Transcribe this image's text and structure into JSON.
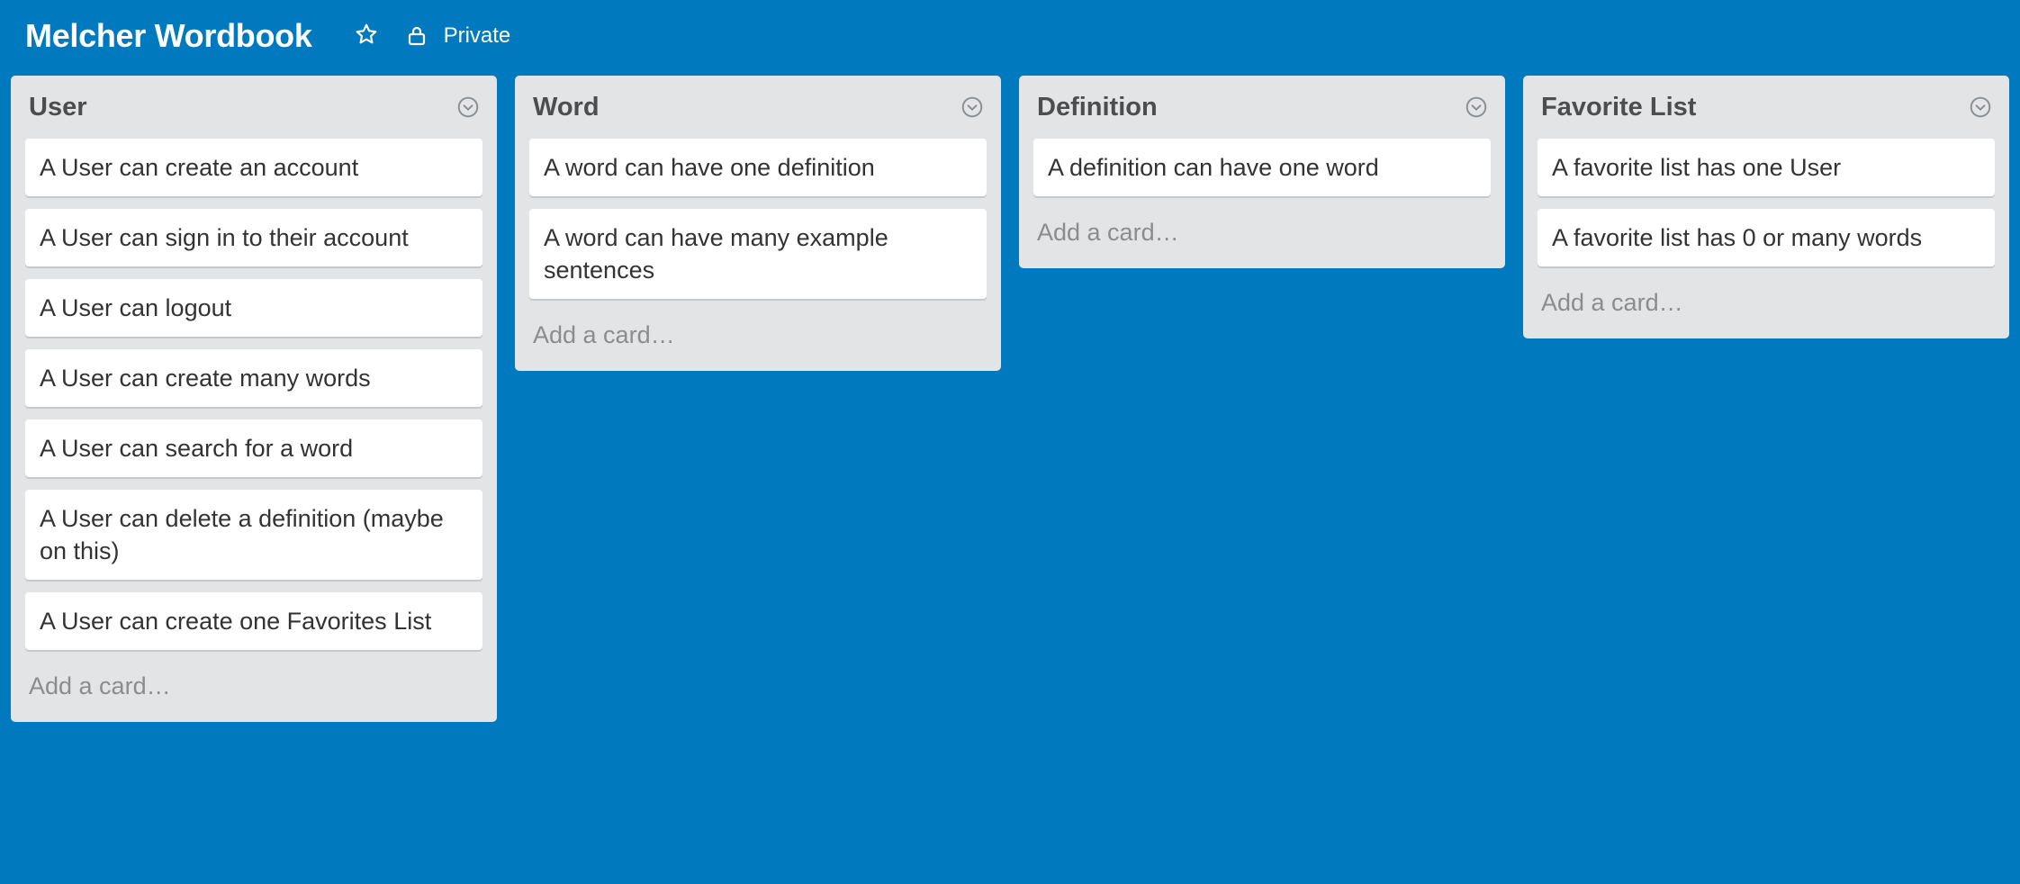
{
  "board": {
    "title": "Melcher Wordbook",
    "visibility": "Private",
    "star_icon": "star-icon",
    "lock_icon": "lock-icon",
    "background_color": "#0079bf"
  },
  "lists": [
    {
      "title": "User",
      "cards": [
        "A User can create an account",
        "A User can sign in to their account",
        "A User can logout",
        "A User can create many words",
        "A User can search for a word",
        "A User can delete a definition (maybe on this)",
        "A User can create one Favorites List"
      ],
      "add_card": "Add a card…"
    },
    {
      "title": "Word",
      "cards": [
        "A word can have one definition",
        "A word can have many example sentences"
      ],
      "add_card": "Add a card…"
    },
    {
      "title": "Definition",
      "cards": [
        "A definition can have one word"
      ],
      "add_card": "Add a card…"
    },
    {
      "title": "Favorite List",
      "cards": [
        "A favorite list has one User",
        "A favorite list has 0 or many words"
      ],
      "add_card": "Add a card…"
    }
  ]
}
